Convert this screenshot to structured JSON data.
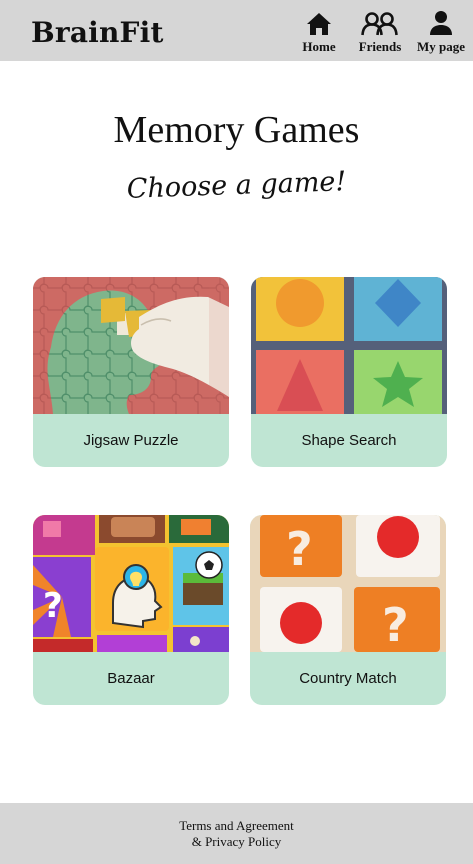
{
  "header": {
    "brand": "BrainFit",
    "nav": [
      {
        "label": "Home",
        "icon": "home-icon"
      },
      {
        "label": "Friends",
        "icon": "friends-icon"
      },
      {
        "label": "My page",
        "icon": "user-icon"
      }
    ]
  },
  "main": {
    "title": "Memory Games",
    "subtitle": "Choose a game!",
    "games": [
      {
        "label": "Jigsaw Puzzle",
        "image": "jigsaw-puzzle-image"
      },
      {
        "label": "Shape Search",
        "image": "shape-search-image"
      },
      {
        "label": "Bazaar",
        "image": "bazaar-image"
      },
      {
        "label": "Country Match",
        "image": "country-match-image"
      }
    ]
  },
  "footer": {
    "line1": "Terms and Agreement",
    "line2": "& Privacy Policy"
  },
  "colors": {
    "header_bg": "#d6d6d6",
    "card_label_bg": "#bfe5d3",
    "footer_bg": "#d6d6d6"
  }
}
